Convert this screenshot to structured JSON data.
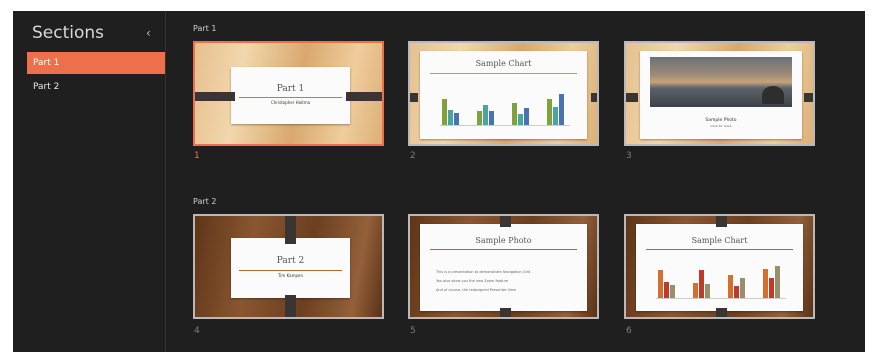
{
  "sidebar": {
    "title": "Sections",
    "items": [
      {
        "label": "Part 1"
      },
      {
        "label": "Part 2"
      }
    ]
  },
  "sections": [
    {
      "label": "Part 1",
      "slides": [
        {
          "number": "1",
          "title": "Part 1",
          "subtitle": "Christopher Haitma"
        },
        {
          "number": "2",
          "title": "Sample Chart"
        },
        {
          "number": "3",
          "title": "Sample Photo",
          "subtitle": "Click for more"
        }
      ]
    },
    {
      "label": "Part 2",
      "slides": [
        {
          "number": "4",
          "title": "Part 2",
          "subtitle": "Tim Kampen"
        },
        {
          "number": "5",
          "title": "Sample Photo",
          "bullets": [
            "This is a presentation to demonstrate Navigation Grid",
            "You also show you the new Zoom feature",
            "And of course, the redesigned Presenter View"
          ]
        },
        {
          "number": "6",
          "title": "Sample Chart"
        }
      ]
    }
  ],
  "colors": {
    "accent": "#ee6f4c",
    "chart_green": "#7fa33a",
    "chart_teal": "#4da3a3",
    "chart_blue": "#4a72b0",
    "chart_orange": "#d46e2c",
    "chart_red": "#c0392b",
    "chart_khaki": "#9b8e6b"
  }
}
